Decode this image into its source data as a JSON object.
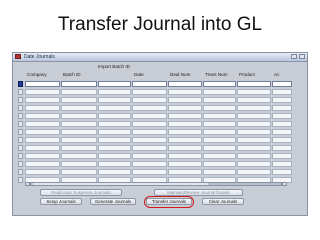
{
  "slide": {
    "title": "Transfer Journal into GL"
  },
  "window": {
    "title": "Date Journals"
  },
  "form": {
    "group_header": "Import Batch ID",
    "columns": [
      "Company",
      "Batch ID",
      "Date",
      "Deal Num",
      "Trans Num",
      "Product",
      "Ac"
    ],
    "row_count": 13,
    "active_row": 1
  },
  "buttons": {
    "reallocate": "Reallocate Suspense Journals",
    "maintain": "Maintain/Review Journal Details",
    "setup": "Setup Journals",
    "generate": "Generate Journals",
    "transfer": "Transfer Journals",
    "clear": "Clear Journals"
  }
}
